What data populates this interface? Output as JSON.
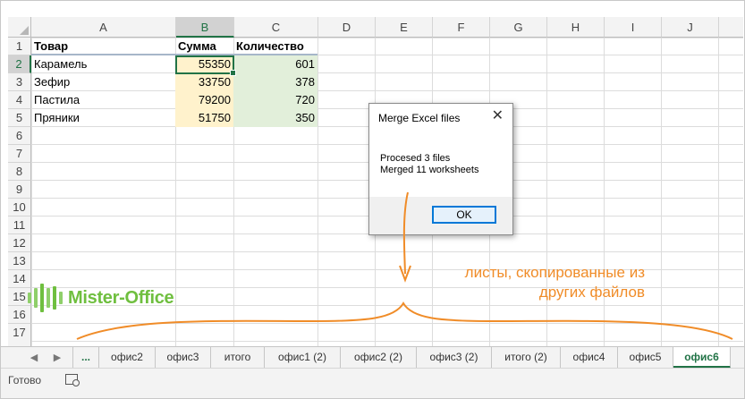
{
  "columns": [
    "A",
    "B",
    "C",
    "D",
    "E",
    "F",
    "G",
    "H",
    "I",
    "J"
  ],
  "rows": [
    "1",
    "2",
    "3",
    "4",
    "5",
    "6",
    "7",
    "8",
    "9",
    "10",
    "11",
    "12",
    "13",
    "14",
    "15",
    "16",
    "17"
  ],
  "table": {
    "headers": [
      "Товар",
      "Сумма",
      "Количество"
    ],
    "data": [
      [
        "Карамель",
        "55350",
        "601"
      ],
      [
        "Зефир",
        "33750",
        "378"
      ],
      [
        "Пастила",
        "79200",
        "720"
      ],
      [
        "Пряники",
        "51750",
        "350"
      ]
    ]
  },
  "logo": {
    "text": "Mister-Office"
  },
  "dialog": {
    "title": "Merge Excel files",
    "close": "✕",
    "line1": "Procesed 3 files",
    "line2": "Merged 11 worksheets",
    "ok_label": "OK"
  },
  "annotation": {
    "line1": "листы, скопированные из",
    "line2": "других файлов"
  },
  "tabs": {
    "ellipsis": "...",
    "prev_icon": "◀",
    "next_icon": "▶",
    "items": [
      "офис2",
      "офис3",
      "итого",
      "офис1 (2)",
      "офис2 (2)",
      "офис3 (2)",
      "итого (2)",
      "офис4",
      "офис5",
      "офис6"
    ],
    "active": "офис6"
  },
  "status": {
    "text": "Готово"
  },
  "colors": {
    "excel_green": "#217346",
    "annotation_orange": "#f08c28",
    "yellow_fill": "#fff2cc",
    "green_fill": "#e2efda"
  }
}
